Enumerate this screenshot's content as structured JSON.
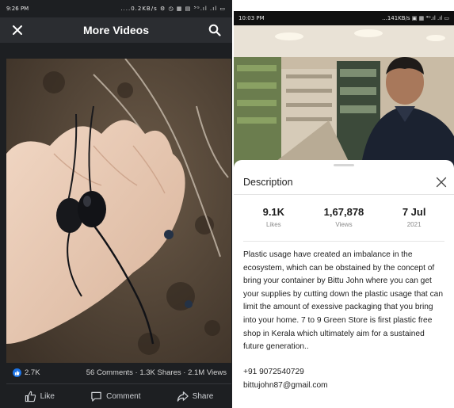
{
  "left": {
    "status": {
      "time": "9:26 PM",
      "right": "....0.2KB/s  ⚙  ◷  ▦  ▤  ⁵ᴳ.ıl  .ıl  ▭"
    },
    "topbar": {
      "title": "More Videos"
    },
    "stats": {
      "reactions": "2.7K",
      "summary": "56 Comments · 1.3K Shares · 2.1M Views"
    },
    "actions": {
      "like": "Like",
      "comment": "Comment",
      "share": "Share"
    }
  },
  "right": {
    "status": {
      "time": "10:03 PM",
      "right": "...141KB/s ▣ ▦ ⁴ᴳ.ıl .ıl ▭"
    },
    "sheet": {
      "title": "Description",
      "metrics": [
        {
          "value": "9.1K",
          "label": "Likes"
        },
        {
          "value": "1,67,878",
          "label": "Views"
        },
        {
          "value": "7 Jul",
          "label": "2021"
        }
      ],
      "description": "Plastic usage have created an imbalance in the ecosystem, which can be obstained by the concept of bring your container by Bittu John where you can get your supplies by cutting down the plastic usage that can limit the amount of exessive packaging that you bring into your home. 7 to 9 Green Store is first plastic free shop in Kerala which ultimately aim for a sustained future generation..",
      "phone": "+91 9072540729",
      "email": "bittujohn87@gmail.com"
    }
  },
  "colors": {
    "accent_like": "#1d74e6",
    "dark_bg": "#1d1f22",
    "topbar": "#2b2d31"
  }
}
